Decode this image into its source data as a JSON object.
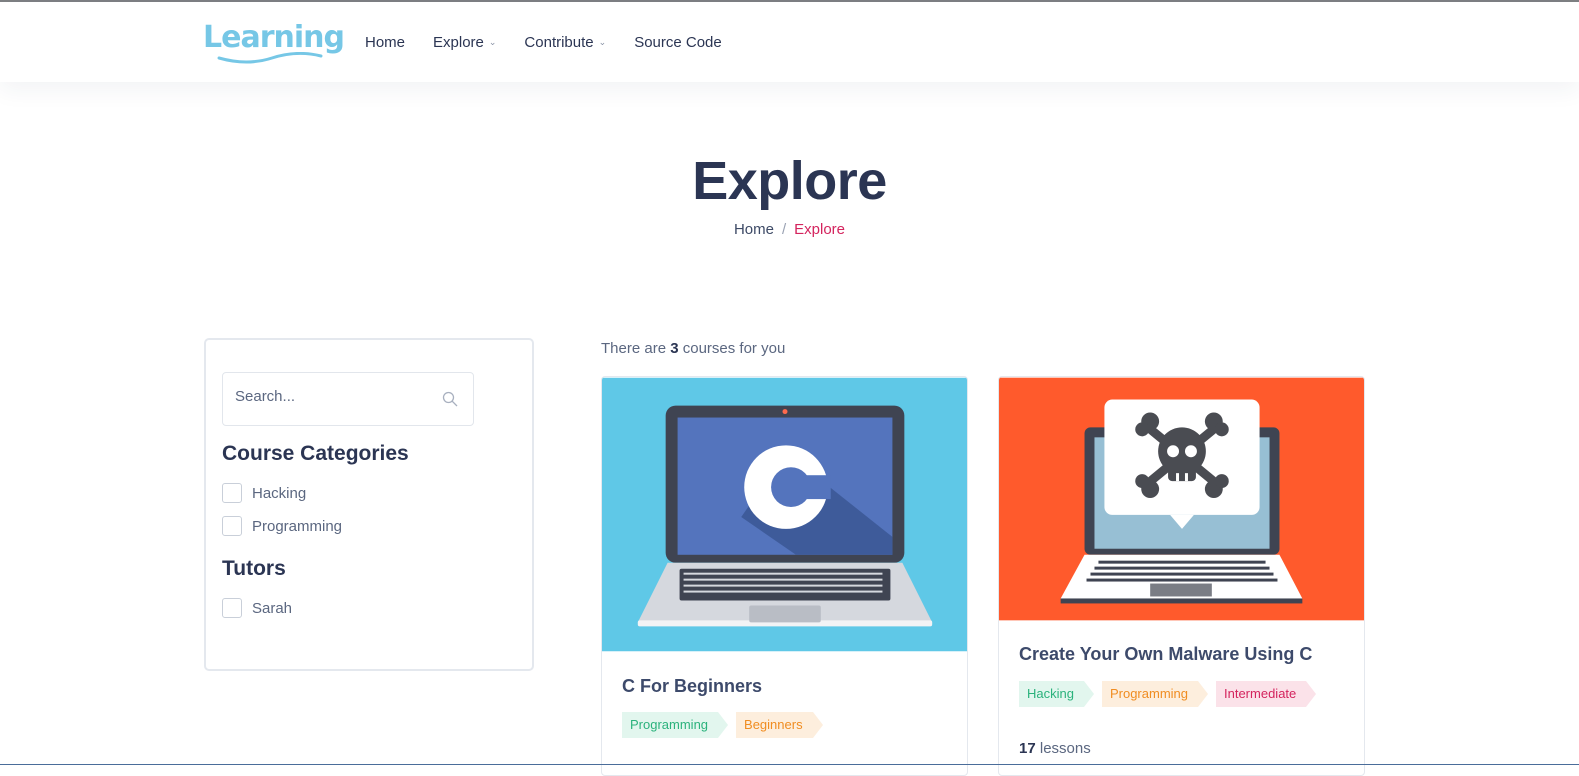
{
  "header": {
    "logo_text": "Learning",
    "nav": [
      {
        "label": "Home",
        "has_dropdown": false
      },
      {
        "label": "Explore",
        "has_dropdown": true
      },
      {
        "label": "Contribute",
        "has_dropdown": true
      },
      {
        "label": "Source Code",
        "has_dropdown": false
      }
    ]
  },
  "hero": {
    "title": "Explore",
    "breadcrumb": {
      "home": "Home",
      "separator": "/",
      "current": "Explore"
    }
  },
  "sidebar": {
    "search": {
      "placeholder": "Search...",
      "value": ""
    },
    "categories_title": "Course Categories",
    "categories": [
      "Hacking",
      "Programming"
    ],
    "tutors_title": "Tutors",
    "tutors": [
      "Sarah"
    ]
  },
  "results": {
    "prefix": "There are",
    "count": "3",
    "suffix": "courses for you"
  },
  "courses": [
    {
      "title": "C For Beginners",
      "tags": [
        "Programming",
        "Beginners"
      ],
      "thumb_bg": "#5fc8e7"
    },
    {
      "title": "Create Your Own Malware Using C",
      "tags": [
        "Hacking",
        "Programming",
        "Intermediate"
      ],
      "lessons_count": "17",
      "lessons_label": "lessons",
      "thumb_bg": "#ff5a2c"
    }
  ],
  "colors": {
    "accent": "#d4245e",
    "logo": "#76c7e6",
    "heading": "#2b3553"
  }
}
